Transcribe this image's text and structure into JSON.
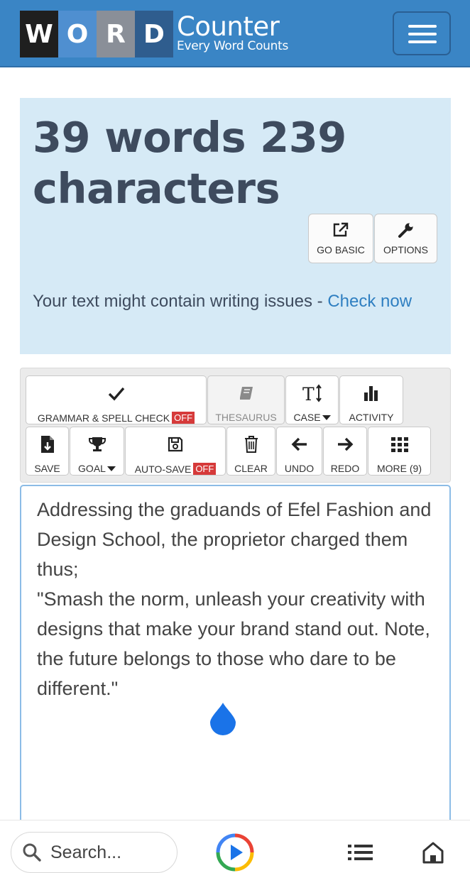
{
  "header": {
    "logo_letters": [
      "W",
      "O",
      "R",
      "D"
    ],
    "logo_colors": [
      "#1f1f1f",
      "#4f8fd0",
      "#8a8f98",
      "#2f5d8e"
    ],
    "logo_title": "Counter",
    "logo_tagline": "Every Word Counts",
    "menu_icon": "hamburger-menu-icon"
  },
  "stats": {
    "count_text": "39 words 239 characters",
    "go_basic_label": "GO BASIC",
    "options_label": "OPTIONS",
    "issues_text": "Your text might contain writing issues - ",
    "check_now_label": "Check now"
  },
  "toolbar": {
    "grammar_label": "GRAMMAR & SPELL CHECK",
    "grammar_state": "OFF",
    "thesaurus_label": "THESAURUS",
    "case_label": "CASE",
    "activity_label": "ACTIVITY",
    "save_label": "SAVE",
    "goal_label": "GOAL",
    "autosave_label": "AUTO-SAVE",
    "autosave_state": "OFF",
    "clear_label": "CLEAR",
    "undo_label": "UNDO",
    "redo_label": "REDO",
    "more_label": "MORE (9)"
  },
  "editor": {
    "text": "Addressing the graduands of Efel Fashion and Design School, the proprietor charged them thus;\n\"Smash the norm, unleash your creativity with designs that make your brand stand out. Note, the future belongs to those who dare to be different.\""
  },
  "bottombar": {
    "search_placeholder": "Search..."
  },
  "colors": {
    "header_bg": "#3a85c5",
    "panel_bg": "#d6eaf6",
    "link": "#2f7fc1",
    "off_badge": "#d63a3a",
    "cursor_drop": "#1a73e8"
  }
}
